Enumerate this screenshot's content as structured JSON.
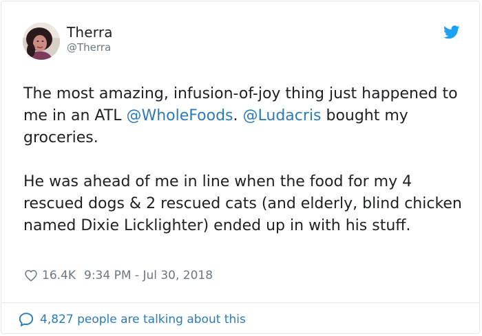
{
  "author": {
    "name": "Therra",
    "handle": "@Therra"
  },
  "tweet": {
    "p1_a": "The most amazing, infusion-of-joy thing just happened to me in an ATL ",
    "mention1": "@WholeFoods",
    "p1_b": ". ",
    "mention2": "@Ludacris",
    "p1_c": " bought my groceries.",
    "p2": "He was ahead of me in line when the food for my 4 rescued dogs & 2 rescued cats (and elderly, blind chicken named Dixie Licklighter) ended up in with his stuff."
  },
  "meta": {
    "likes": "16.4K",
    "timestamp": "9:34 PM - Jul 30, 2018"
  },
  "footer": {
    "talking": "4,827 people are talking about this"
  },
  "colors": {
    "link": "#2b7bb9",
    "twitter_blue": "#1da1f2",
    "secondary_text": "#697882",
    "border": "#e1e8ed"
  },
  "icons": [
    "avatar",
    "twitter-bird-icon",
    "heart-icon",
    "speech-bubble-icon"
  ]
}
